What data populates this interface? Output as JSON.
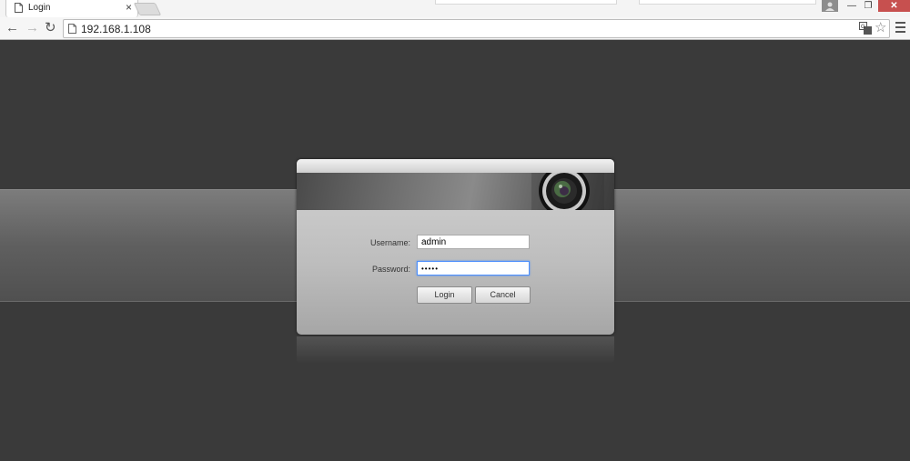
{
  "browser": {
    "tab": {
      "title": "Login",
      "close_glyph": "×"
    },
    "nav": {
      "back": "←",
      "forward": "→",
      "reload": "↻"
    },
    "address": {
      "url": "192.168.1.108"
    },
    "star": "☆",
    "window": {
      "minimize": "—",
      "maximize": "❐",
      "close": "✕"
    }
  },
  "login": {
    "username_label": "Username:",
    "username_value": "admin",
    "password_label": "Password:",
    "password_value": "•••••",
    "login_button": "Login",
    "cancel_button": "Cancel"
  },
  "icons": [
    "page-icon",
    "translate-icon",
    "star-icon",
    "menu-icon",
    "user-icon",
    "camera-lens-icon"
  ]
}
